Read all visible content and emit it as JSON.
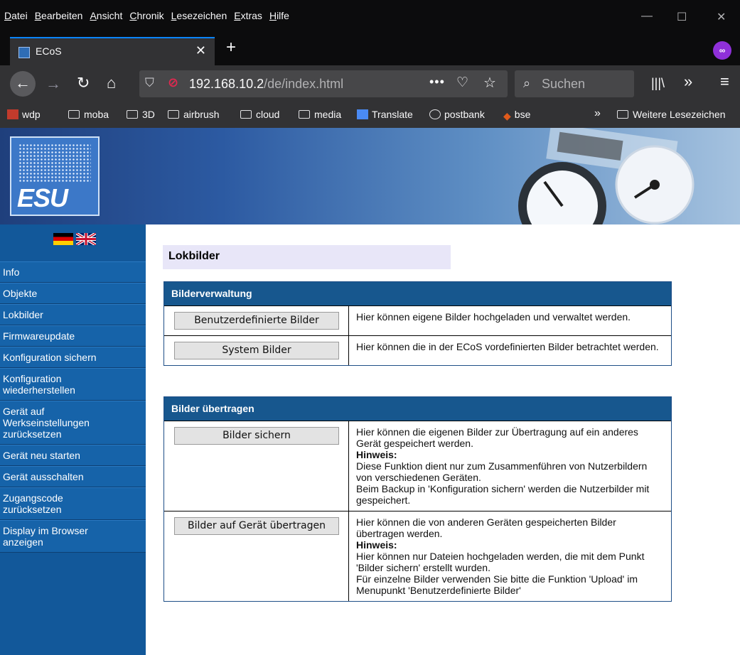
{
  "browser": {
    "menu": [
      "Datei",
      "Bearbeiten",
      "Ansicht",
      "Chronik",
      "Lesezeichen",
      "Extras",
      "Hilfe"
    ],
    "tab_title": "ECoS",
    "url_host": "192.168.10.2",
    "url_path": "/de/index.html",
    "search_placeholder": "Suchen",
    "bookmarks": [
      "wdp",
      "moba",
      "3D",
      "airbrush",
      "cloud",
      "media",
      "Translate",
      "postbank",
      "bse"
    ],
    "more_bookmarks": "Weitere Lesezeichen"
  },
  "colors": {
    "accent": "#0a84ff",
    "nav_blue": "#1663a9",
    "section_head": "#17578e",
    "title_bg": "#e8e6f8"
  },
  "banner": {
    "logo_text": "ESU"
  },
  "sidebar": {
    "items": [
      "Info",
      "Objekte",
      "Lokbilder",
      "Firmwareupdate",
      "Konfiguration sichern",
      "Konfiguration wiederherstellen",
      "Gerät auf Werkseinstellungen zurücksetzen",
      "Gerät neu starten",
      "Gerät ausschalten",
      "Zugangscode zurücksetzen",
      "Display im Browser anzeigen"
    ]
  },
  "main": {
    "title": "Lokbilder",
    "sections": [
      {
        "heading": "Bilderverwaltung",
        "rows": [
          {
            "button": "Benutzerdefinierte Bilder",
            "text": "Hier können eigene Bilder hochgeladen und verwaltet werden."
          },
          {
            "button": "System Bilder",
            "text": "Hier können die in der ECoS vordefinierten Bilder betrachtet werden."
          }
        ]
      },
      {
        "heading": "Bilder übertragen",
        "rows": [
          {
            "button": "Bilder sichern",
            "text": "Hier können die eigenen Bilder zur Übertragung auf ein anderes Gerät gespeichert werden.",
            "hint_label": "Hinweis:",
            "hint_lines": [
              "Diese Funktion dient nur zum Zusammenführen von Nutzerbildern von verschiedenen Geräten.",
              "Beim Backup in 'Konfiguration sichern' werden die Nutzerbilder mit gespeichert."
            ]
          },
          {
            "button": "Bilder auf Gerät übertragen",
            "text": "Hier können die von anderen Geräten gespeicherten Bilder übertragen werden.",
            "hint_label": "Hinweis:",
            "hint_lines": [
              "Hier können nur Dateien hochgeladen werden, die mit dem Punkt 'Bilder sichern' erstellt wurden.",
              "Für einzelne Bilder verwenden Sie bitte die Funktion 'Upload' im Menupunkt 'Benutzerdefinierte Bilder'"
            ]
          }
        ]
      }
    ]
  }
}
